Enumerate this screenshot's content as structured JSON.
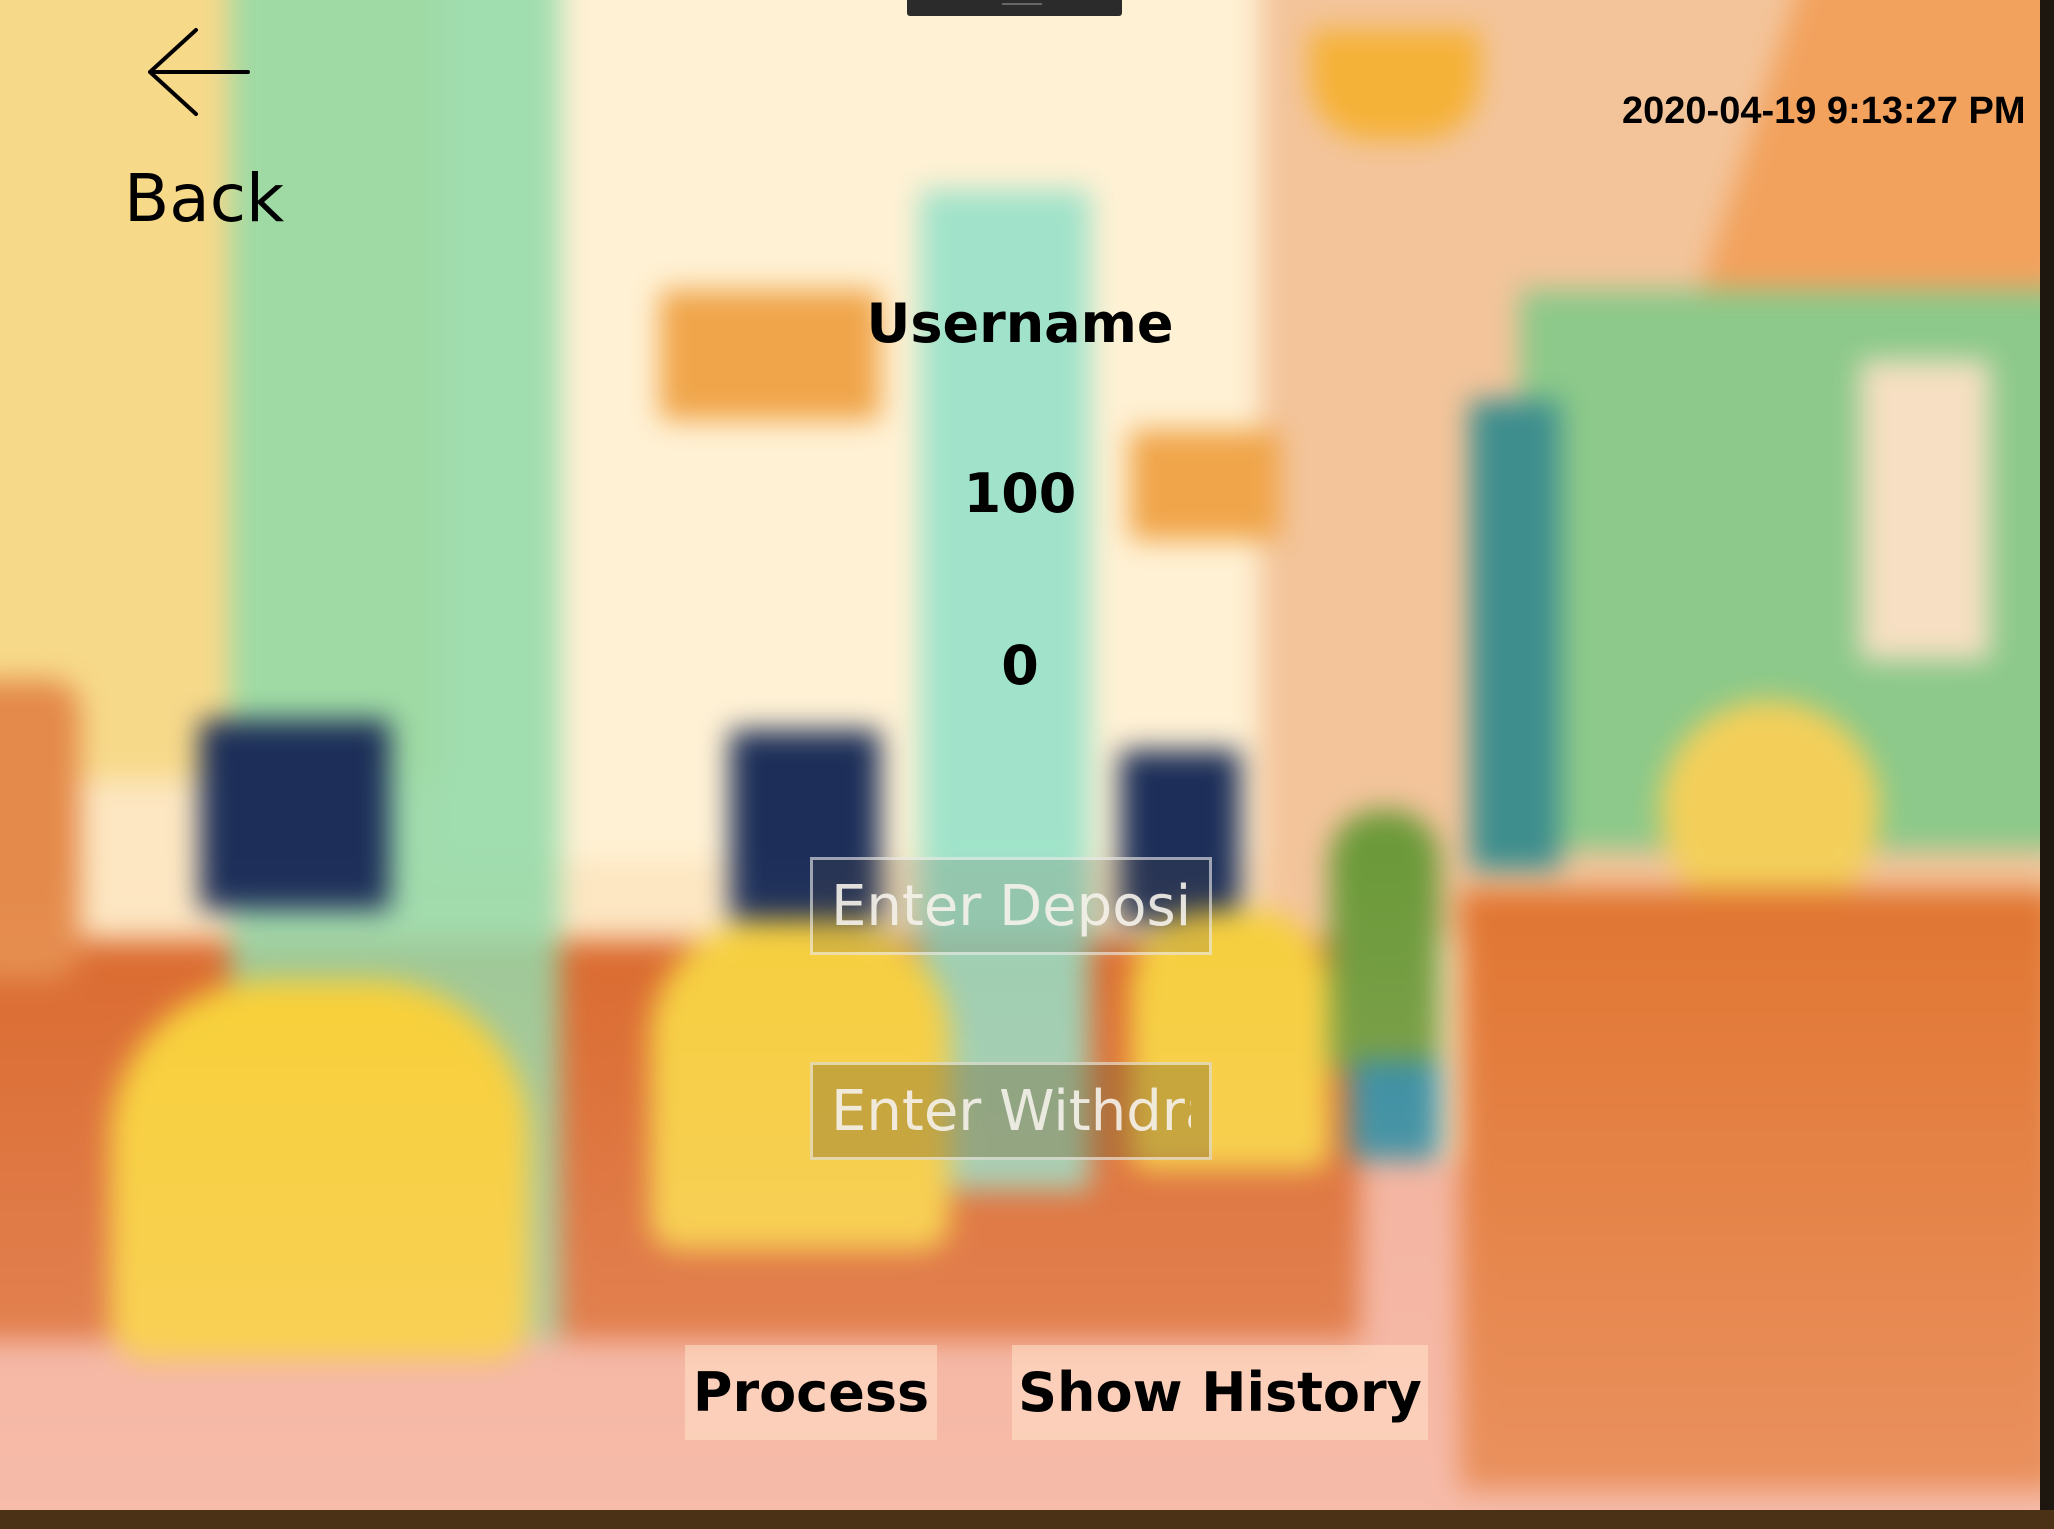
{
  "header": {
    "back_label": "Back",
    "back_icon": "arrow-left-icon",
    "datetime": "2020-04-19 9:13:27 PM"
  },
  "account": {
    "username": "Username",
    "balance": "100",
    "second_value": "0"
  },
  "form": {
    "deposit_placeholder": "Enter Deposit Amount",
    "withdraw_placeholder": "Enter Withdrawal Amount"
  },
  "actions": {
    "process_label": "Process",
    "history_label": "Show History"
  }
}
